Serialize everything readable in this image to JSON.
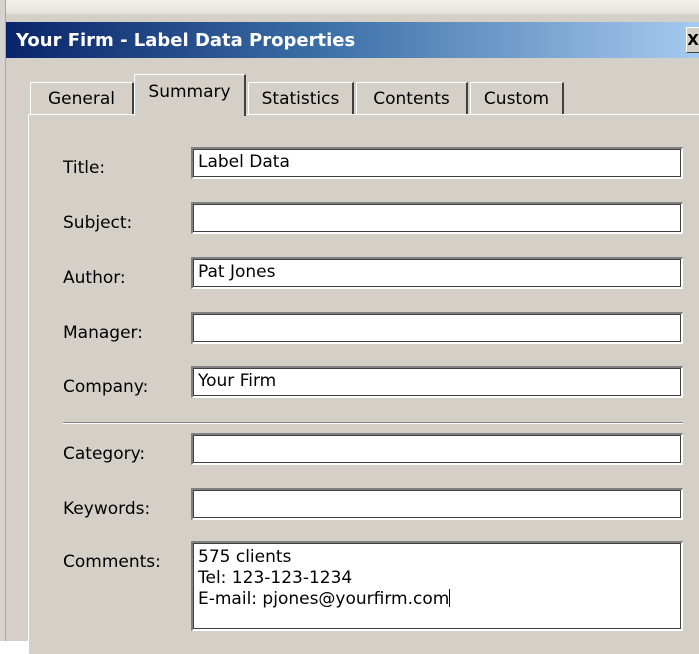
{
  "window": {
    "title": "Your Firm - Label Data Properties",
    "close_glyph": "X"
  },
  "tabs": [
    {
      "label": "General",
      "active": false
    },
    {
      "label": "Summary",
      "active": true
    },
    {
      "label": "Statistics",
      "active": false
    },
    {
      "label": "Contents",
      "active": false
    },
    {
      "label": "Custom",
      "active": false
    }
  ],
  "summary": {
    "title_label": "Title:",
    "title_value": "Label Data",
    "subject_label": "Subject:",
    "subject_value": "",
    "author_label": "Author:",
    "author_value": "Pat Jones",
    "manager_label": "Manager:",
    "manager_value": "",
    "company_label": "Company:",
    "company_value": "Your Firm",
    "category_label": "Category:",
    "category_value": "",
    "keywords_label": "Keywords:",
    "keywords_value": "",
    "comments_label": "Comments:",
    "comments_value": "575 clients\nTel: 123-123-1234\nE-mail: pjones@yourfirm.com"
  }
}
